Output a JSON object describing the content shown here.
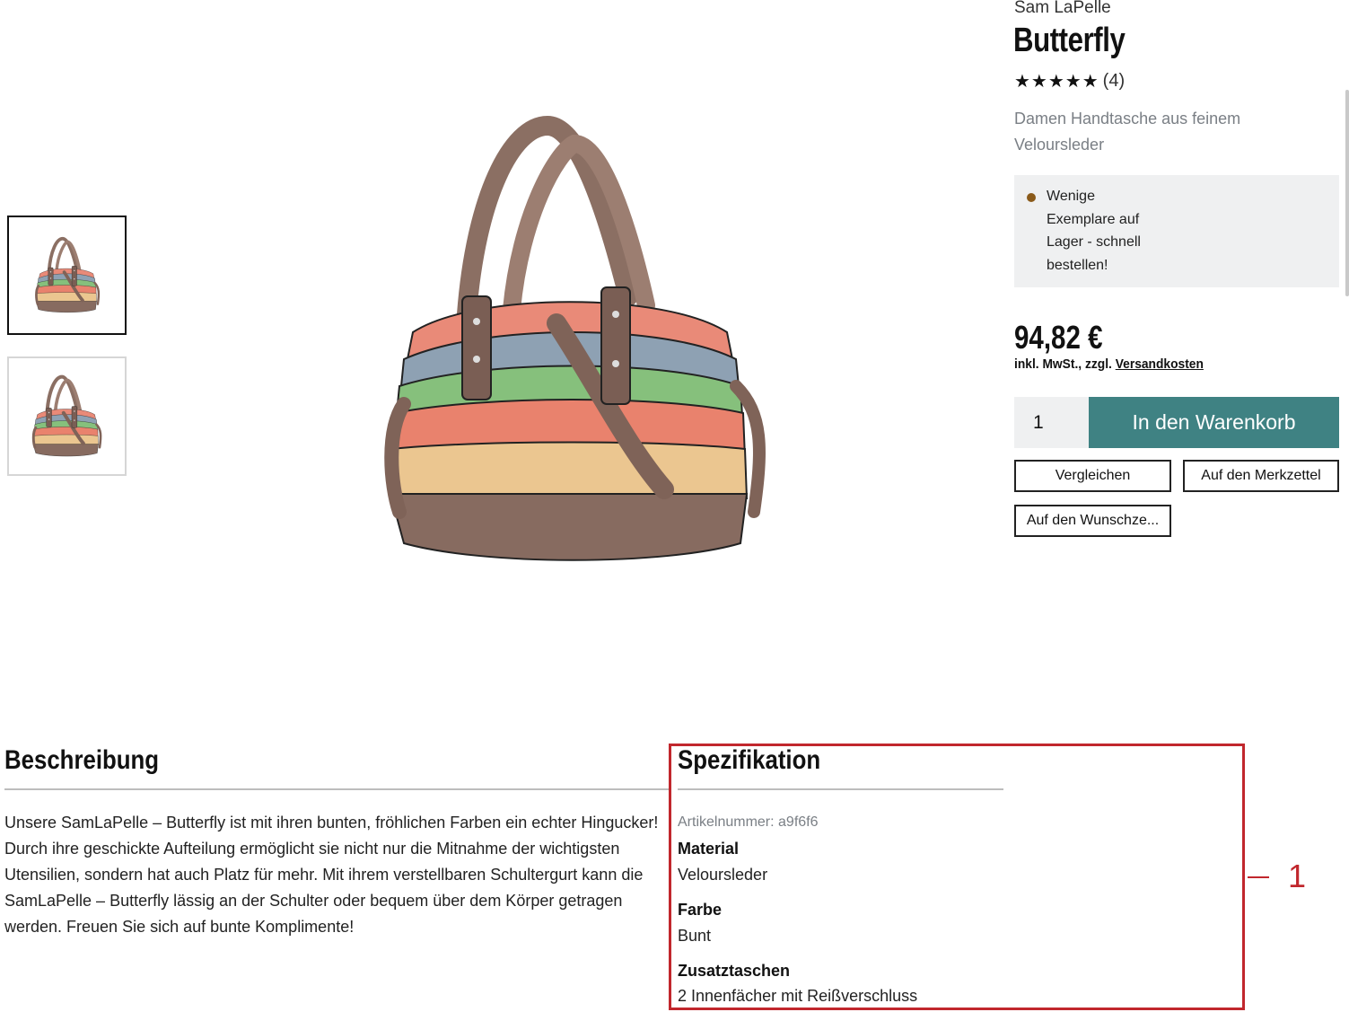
{
  "product": {
    "brand": "Sam LaPelle",
    "title": "Butterfly",
    "rating_stars": "★★★★★",
    "rating_count": "(4)",
    "subtitle": "Damen Handtasche aus feinem Veloursleder",
    "stock_text": "Wenige Exemplare auf Lager - schnell bestellen!",
    "stock_color": "#8a5a1a",
    "price": "94,82 €",
    "tax_prefix": "inkl. MwSt., zzgl.",
    "shipping_link": "Versandkosten",
    "quantity": "1",
    "add_to_cart": "In den Warenkorb",
    "accent_color": "#3f8283",
    "compare": "Vergleichen",
    "bookmark": "Auf den Merkzettel",
    "wishlist": "Auf den Wunschze..."
  },
  "description": {
    "heading": "Beschreibung",
    "text": "Unsere SamLaPelle – Butterfly ist mit ihren bunten, fröhlichen Farben ein echter Hingucker! Durch ihre geschickte Aufteilung ermöglicht sie nicht nur die Mitnahme der wichtigsten Utensilien, sondern hat auch Platz für mehr. Mit ihrem verstellbaren Schultergurt kann die SamLaPelle – Butterfly lässig an der Schulter oder bequem über dem Körper getragen werden. Freuen Sie sich auf bunte Komplimente!"
  },
  "specification": {
    "heading": "Spezifikation",
    "article_number": "Artikelnummer: a9f6f6",
    "items": [
      {
        "label": "Material",
        "value": "Veloursleder"
      },
      {
        "label": "Farbe",
        "value": "Bunt"
      },
      {
        "label": "Zusatztaschen",
        "value": "2 Innenfächer mit Reißverschluss"
      }
    ]
  },
  "annotation": {
    "number": "1",
    "color": "#c1272d"
  }
}
